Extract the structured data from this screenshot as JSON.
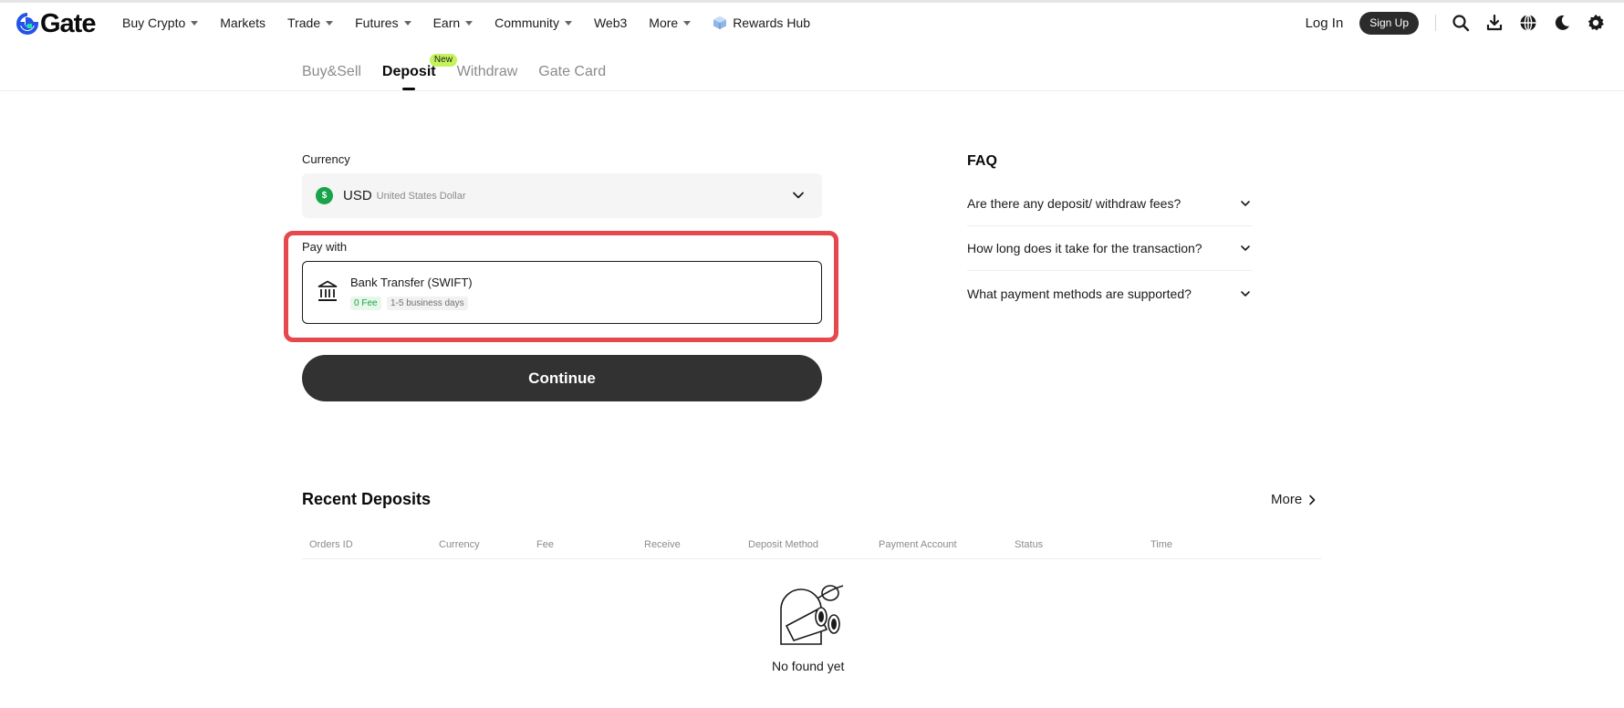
{
  "brand": {
    "name": "Gate",
    "logo_color": "#2354e6"
  },
  "nav": {
    "items": [
      {
        "label": "Buy Crypto",
        "caret": true
      },
      {
        "label": "Markets",
        "caret": false
      },
      {
        "label": "Trade",
        "caret": true
      },
      {
        "label": "Futures",
        "caret": true
      },
      {
        "label": "Earn",
        "caret": true
      },
      {
        "label": "Community",
        "caret": true
      },
      {
        "label": "Web3",
        "caret": false
      },
      {
        "label": "More",
        "caret": true
      }
    ],
    "rewards_hub": "Rewards Hub"
  },
  "header": {
    "login": "Log In",
    "signup": "Sign Up",
    "icons": [
      "search-icon",
      "download-icon",
      "globe-icon",
      "moon-icon",
      "settings-icon"
    ]
  },
  "subtabs": {
    "items": [
      "Buy&Sell",
      "Deposit",
      "Withdraw",
      "Gate Card"
    ],
    "active": "Deposit",
    "new_badge": "New"
  },
  "form": {
    "currency_label": "Currency",
    "currency_code": "USD",
    "currency_name": "United States Dollar",
    "currency_symbol": "$",
    "pay_with_label": "Pay with",
    "payment_method": {
      "title": "Bank Transfer (SWIFT)",
      "fee_tag": "0 Fee",
      "time_tag": "1-5 business days"
    },
    "continue_label": "Continue",
    "highlight_color": "#e5484d"
  },
  "faq": {
    "title": "FAQ",
    "items": [
      "Are there any deposit/ withdraw fees?",
      "How long does it take for the transaction?",
      "What payment methods are supported?"
    ]
  },
  "recent": {
    "title": "Recent Deposits",
    "more": "More",
    "columns": [
      "Orders ID",
      "Currency",
      "Fee",
      "Receive",
      "Deposit Method",
      "Payment Account",
      "Status",
      "Time"
    ],
    "empty_text": "No found yet"
  }
}
